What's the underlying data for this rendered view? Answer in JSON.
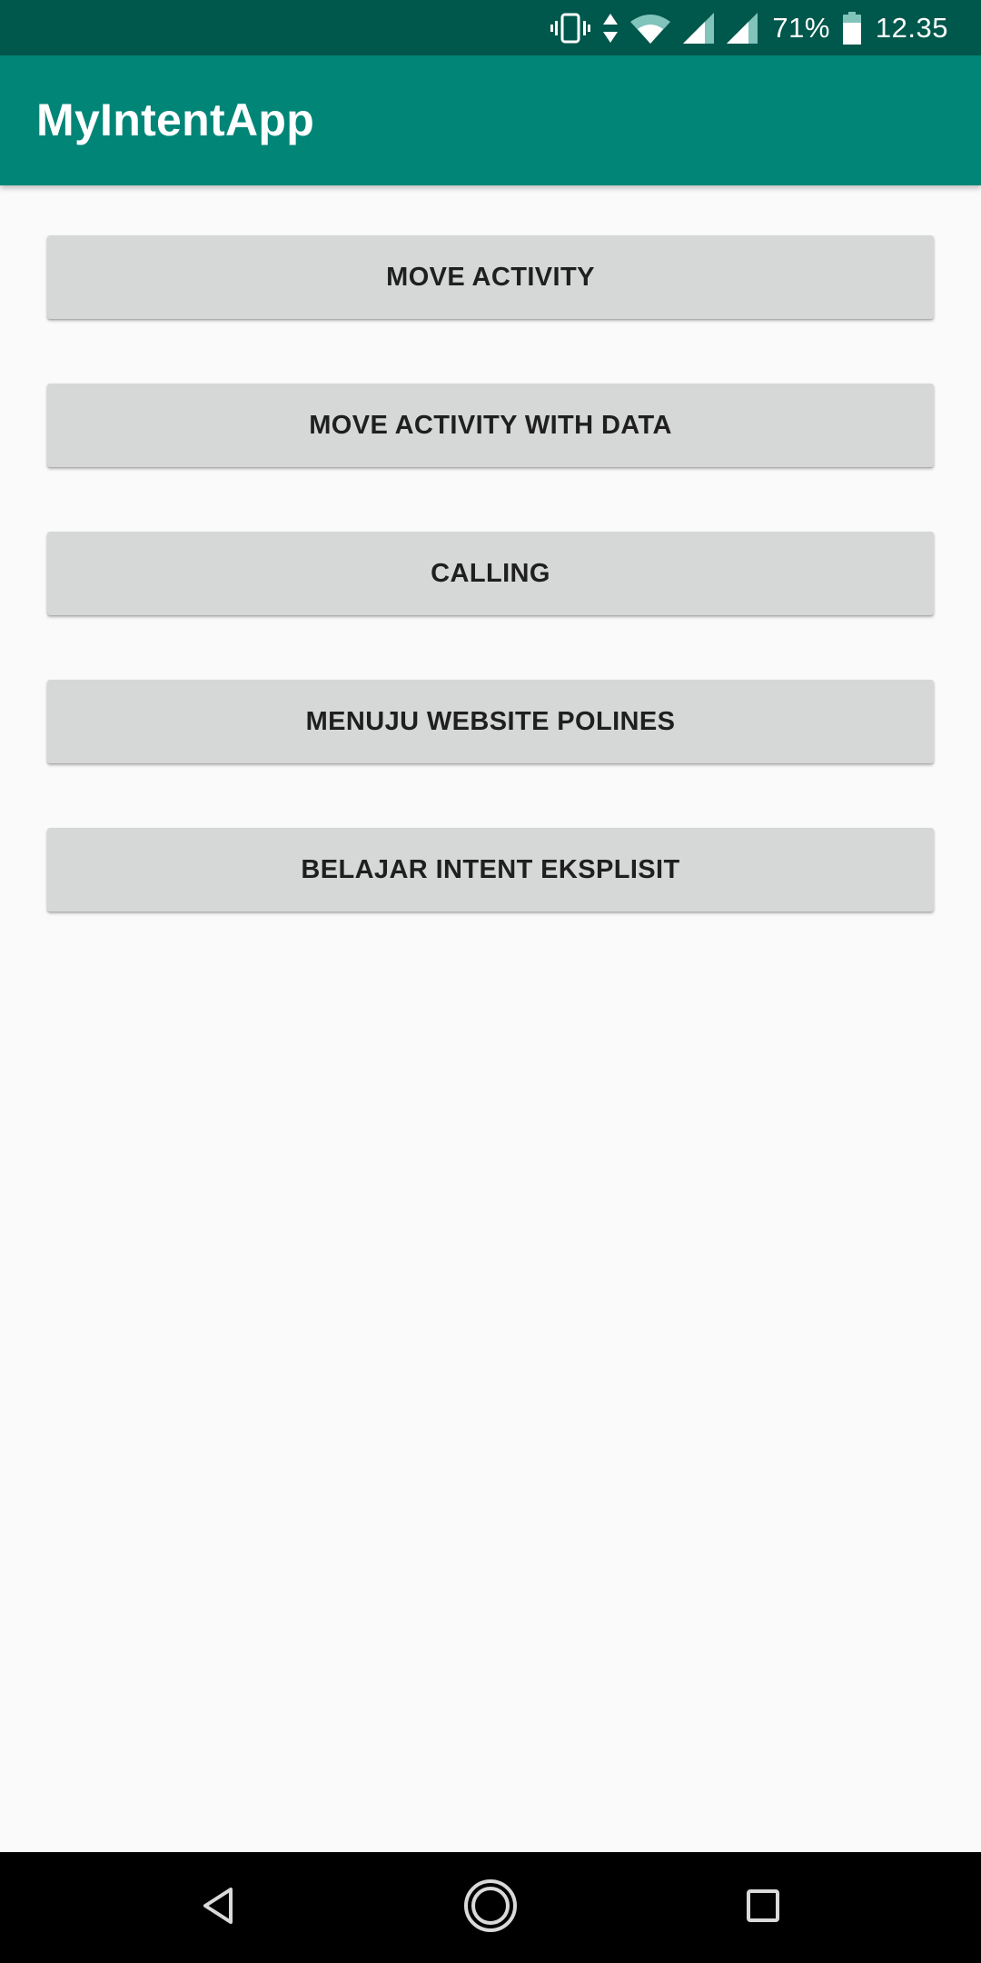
{
  "status_bar": {
    "battery_percent": "71%",
    "time": "12.35",
    "icons": [
      "vibrate-icon",
      "data-arrows-icon",
      "wifi-icon",
      "signal-icon",
      "signal-icon",
      "battery-icon"
    ]
  },
  "app_bar": {
    "title": "MyIntentApp"
  },
  "buttons": [
    {
      "label": "MOVE ACTIVITY"
    },
    {
      "label": "MOVE ACTIVITY WITH DATA"
    },
    {
      "label": "CALLING"
    },
    {
      "label": "MENUJU WEBSITE POLINES"
    },
    {
      "label": "BELAJAR INTENT EKSPLISIT"
    }
  ],
  "nav_bar": {
    "icons": [
      "back-icon",
      "home-icon",
      "recents-icon"
    ]
  },
  "colors": {
    "status_bar": "#00574b",
    "app_bar": "#008577",
    "background": "#fafafa",
    "button": "#d6d7d7",
    "button_text": "#1f1f1f",
    "nav_bar": "#000000"
  }
}
